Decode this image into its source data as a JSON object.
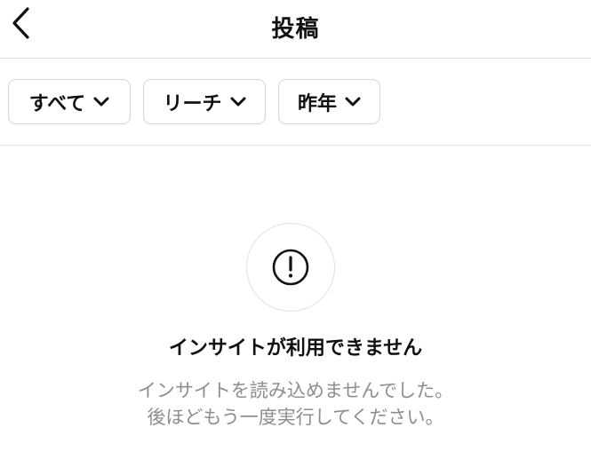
{
  "header": {
    "title": "投稿",
    "back_icon": "chevron-left-icon"
  },
  "filters": [
    {
      "label": "すべて",
      "icon": "chevron-down-icon"
    },
    {
      "label": "リーチ",
      "icon": "chevron-down-icon"
    },
    {
      "label": "昨年",
      "icon": "chevron-down-icon"
    }
  ],
  "empty_state": {
    "icon": "exclamation-circle-icon",
    "title": "インサイトが利用できません",
    "message_line1": "インサイトを読み込めませんでした。",
    "message_line2": "後ほどもう一度実行してください。"
  },
  "colors": {
    "text_primary": "#111111",
    "text_secondary": "#8e8e8e",
    "border": "#d6d6d6",
    "divider": "#e3e3e3"
  }
}
